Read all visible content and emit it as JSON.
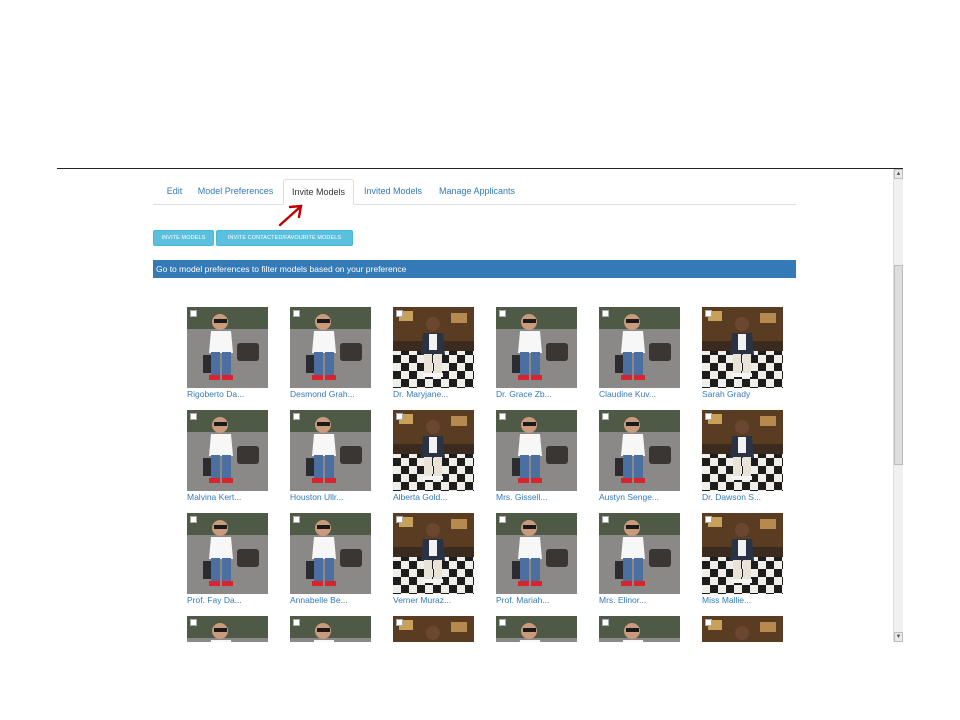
{
  "tabs": [
    {
      "label": "Edit",
      "active": false
    },
    {
      "label": "Model Preferences",
      "active": false
    },
    {
      "label": "Invite Models",
      "active": true
    },
    {
      "label": "Invited Models",
      "active": false
    },
    {
      "label": "Manage Applicants",
      "active": false
    }
  ],
  "actions": {
    "invite_models_label": "INVITE MODELS",
    "invite_contacted_label": "INVITE CONTACTED/FAVOURITE MODELS"
  },
  "info_bar": {
    "text": "Go to model preferences to filter models based on your preference"
  },
  "colors": {
    "link": "#337ab7",
    "info_bar": "#337ab7",
    "button_teal": "#5bc0de",
    "arrow": "#c00000"
  },
  "models": [
    {
      "name": "Rigoberto Da...",
      "photo": "boy-white-shirt"
    },
    {
      "name": "Desmond Grah...",
      "photo": "boy-white-shirt"
    },
    {
      "name": "Dr. Maryjane...",
      "photo": "boy-checkered-floor"
    },
    {
      "name": "Dr. Grace Zb...",
      "photo": "boy-white-shirt"
    },
    {
      "name": "Claudine Kuv...",
      "photo": "boy-white-shirt"
    },
    {
      "name": "Sarah Grady",
      "photo": "boy-checkered-floor"
    },
    {
      "name": "Malvina Kert...",
      "photo": "boy-white-shirt"
    },
    {
      "name": "Houston Ullr...",
      "photo": "boy-white-shirt"
    },
    {
      "name": "Alberta Gold...",
      "photo": "boy-checkered-floor"
    },
    {
      "name": "Mrs. Gissell...",
      "photo": "boy-white-shirt"
    },
    {
      "name": "Austyn Senge...",
      "photo": "boy-white-shirt"
    },
    {
      "name": "Dr. Dawson S...",
      "photo": "boy-checkered-floor"
    },
    {
      "name": "Prof. Fay Da...",
      "photo": "boy-white-shirt"
    },
    {
      "name": "Annabelle Be...",
      "photo": "boy-white-shirt"
    },
    {
      "name": "Verner Muraz...",
      "photo": "boy-checkered-floor"
    },
    {
      "name": "Prof. Mariah...",
      "photo": "boy-white-shirt"
    },
    {
      "name": "Mrs. Elinor...",
      "photo": "boy-white-shirt"
    },
    {
      "name": "Miss Mallie...",
      "photo": "boy-checkered-floor"
    },
    {
      "name": "",
      "photo": "boy-white-shirt"
    },
    {
      "name": "",
      "photo": "boy-white-shirt"
    },
    {
      "name": "",
      "photo": "boy-checkered-floor"
    },
    {
      "name": "",
      "photo": "boy-white-shirt"
    },
    {
      "name": "",
      "photo": "boy-white-shirt"
    },
    {
      "name": "",
      "photo": "boy-checkered-floor"
    }
  ]
}
